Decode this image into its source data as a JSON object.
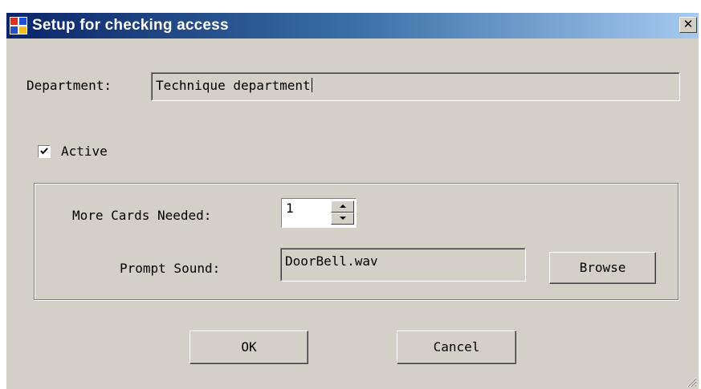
{
  "window": {
    "title": "Setup for checking access",
    "close_glyph": "✕"
  },
  "department": {
    "label": "Department:",
    "value": "Technique department"
  },
  "active": {
    "label": "Active",
    "checked": true
  },
  "group": {
    "more_cards_label": "More Cards Needed:",
    "more_cards_value": "1",
    "prompt_sound_label": "Prompt Sound:",
    "prompt_sound_value": "DoorBell.wav",
    "browse_label": "Browse"
  },
  "buttons": {
    "ok_label": "OK",
    "cancel_label": "Cancel"
  },
  "icons": {
    "app": "app-icon",
    "close": "close-icon",
    "check": "checkmark-icon",
    "spin_up": "arrow-up-icon",
    "spin_down": "arrow-down-icon",
    "grip": "resize-grip-icon"
  },
  "colors": {
    "titlebar_start": "#0a246a",
    "titlebar_end": "#a6caf0",
    "dialog_face": "#d4d0c8"
  }
}
